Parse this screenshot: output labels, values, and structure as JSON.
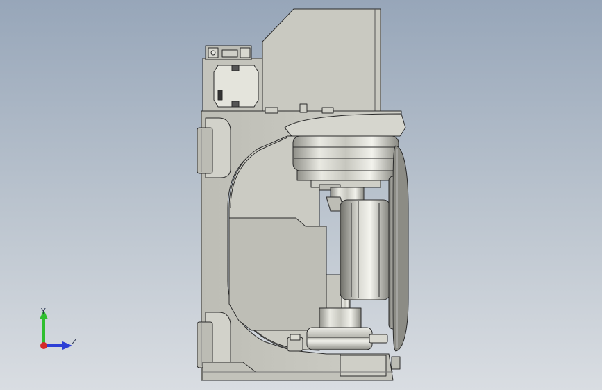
{
  "viewport": {
    "background_top": "#97a6b9",
    "background_bottom": "#d9dde2"
  },
  "model": {
    "fill_color": "#c8c8c0",
    "edge_color": "#2a2a2a",
    "shade_color": "#9c9c94",
    "highlight_color": "#f4f4ee"
  },
  "triad": {
    "y_label": "Y",
    "z_label": "Z",
    "y_color": "#2fbf2f",
    "z_color": "#2d3fd6",
    "x_color": "#d42a2a"
  }
}
